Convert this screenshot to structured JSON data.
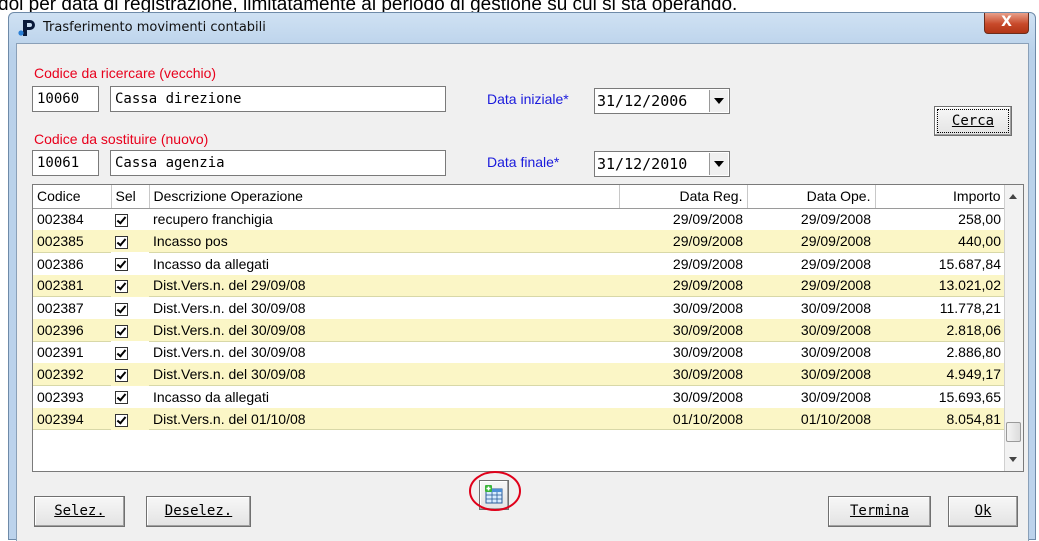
{
  "background_doc": {
    "text": "dol per data di registrazione, limitatamente al periodo di gestione su cui si sta operando."
  },
  "window": {
    "title": "Trasferimento movimenti contabili",
    "close_label": "X"
  },
  "form": {
    "old_code_label": "Codice da ricercare (vecchio)",
    "old_code": "10060",
    "old_desc": "Cassa direzione",
    "new_code_label": "Codice da sostituire (nuovo)",
    "new_code": "10061",
    "new_desc": "Cassa agenzia",
    "start_date_label": "Data iniziale*",
    "start_date": "31/12/2006",
    "end_date_label": "Data finale*",
    "end_date": "31/12/2010",
    "search_button": "Cerca"
  },
  "grid": {
    "columns": [
      "Codice",
      "Sel",
      "Descrizione Operazione",
      "Data Reg.",
      "Data Ope.",
      "Importo"
    ],
    "rows": [
      {
        "code": "002384",
        "sel": true,
        "desc": "recupero franchigia",
        "data_reg": "29/09/2008",
        "data_ope": "29/09/2008",
        "importo": "258,00"
      },
      {
        "code": "002385",
        "sel": true,
        "desc": "Incasso pos",
        "data_reg": "29/09/2008",
        "data_ope": "29/09/2008",
        "importo": "440,00"
      },
      {
        "code": "002386",
        "sel": true,
        "desc": "Incasso da allegati",
        "data_reg": "29/09/2008",
        "data_ope": "29/09/2008",
        "importo": "15.687,84"
      },
      {
        "code": "002381",
        "sel": true,
        "desc": "Dist.Vers.n. del 29/09/08",
        "data_reg": "29/09/2008",
        "data_ope": "29/09/2008",
        "importo": "13.021,02"
      },
      {
        "code": "002387",
        "sel": true,
        "desc": "Dist.Vers.n. del 30/09/08",
        "data_reg": "30/09/2008",
        "data_ope": "30/09/2008",
        "importo": "11.778,21"
      },
      {
        "code": "002396",
        "sel": true,
        "desc": "Dist.Vers.n. del 30/09/08",
        "data_reg": "30/09/2008",
        "data_ope": "30/09/2008",
        "importo": "2.818,06"
      },
      {
        "code": "002391",
        "sel": true,
        "desc": "Dist.Vers.n. del 30/09/08",
        "data_reg": "30/09/2008",
        "data_ope": "30/09/2008",
        "importo": "2.886,80"
      },
      {
        "code": "002392",
        "sel": true,
        "desc": "Dist.Vers.n. del 30/09/08",
        "data_reg": "30/09/2008",
        "data_ope": "30/09/2008",
        "importo": "4.949,17"
      },
      {
        "code": "002393",
        "sel": true,
        "desc": "Incasso da allegati",
        "data_reg": "30/09/2008",
        "data_ope": "30/09/2008",
        "importo": "15.693,65"
      },
      {
        "code": "002394",
        "sel": true,
        "desc": "Dist.Vers.n. del 01/10/08",
        "data_reg": "01/10/2008",
        "data_ope": "01/10/2008",
        "importo": "8.054,81"
      }
    ]
  },
  "buttons": {
    "select": "Selez.",
    "deselect": "Deselez.",
    "exit": "Termina",
    "ok": "Ok"
  },
  "icons": {
    "app": "app-p-icon",
    "toolbar": "table-add-icon"
  },
  "colors": {
    "required_label": "#e8001c",
    "date_label": "#1a1adc",
    "alt_row": "#fbf6c6",
    "highlight_circle": "#e0001a"
  }
}
